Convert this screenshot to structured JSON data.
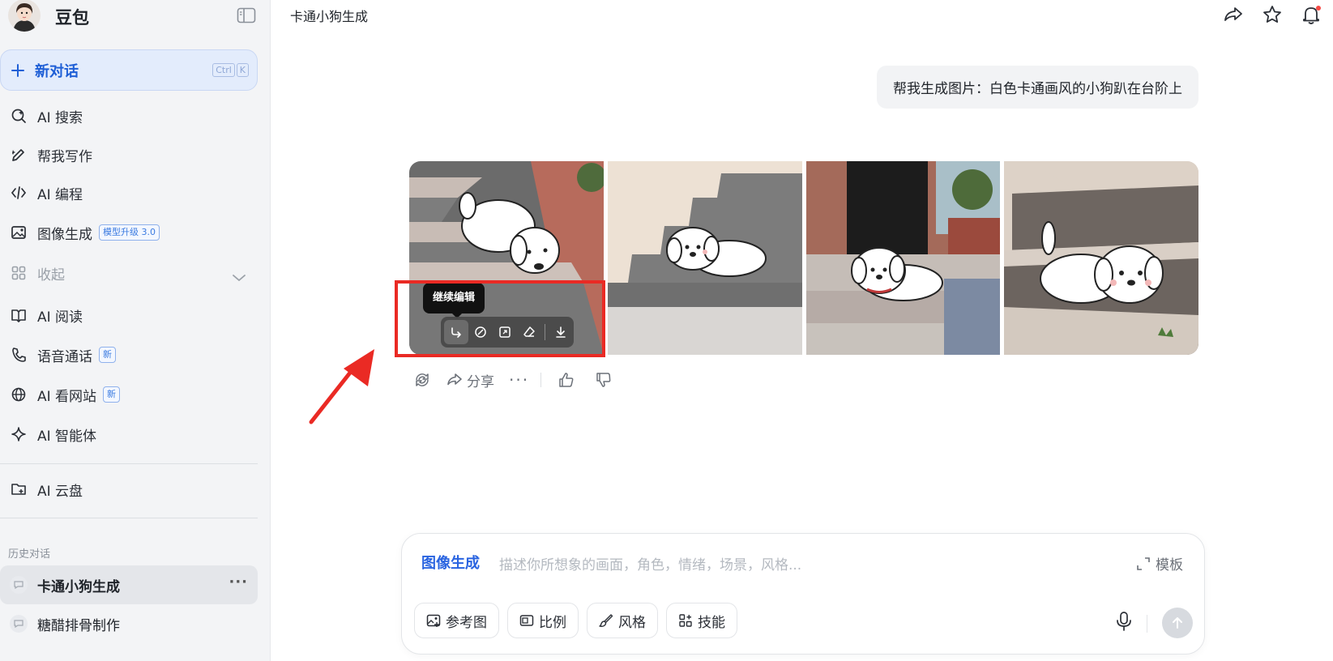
{
  "app": {
    "name": "豆包"
  },
  "sidebar": {
    "new_chat": {
      "label": "新对话",
      "shortcut": [
        "Ctrl",
        "K"
      ]
    },
    "items": [
      {
        "label": "AI 搜索",
        "icon": "search-icon"
      },
      {
        "label": "帮我写作",
        "icon": "pen-icon"
      },
      {
        "label": "AI 编程",
        "icon": "code-icon"
      },
      {
        "label": "图像生成",
        "icon": "image-icon",
        "badge": "模型升级 3.0"
      },
      {
        "label": "收起",
        "icon": "apps-icon",
        "muted": true
      },
      {
        "label": "AI 阅读",
        "icon": "book-icon"
      },
      {
        "label": "语音通话",
        "icon": "phone-icon",
        "badge": "新"
      },
      {
        "label": "AI 看网站",
        "icon": "globe-icon",
        "badge": "新"
      },
      {
        "label": "AI 智能体",
        "icon": "sparkle-icon"
      },
      {
        "label": "AI 云盘",
        "icon": "cloud-drive-icon"
      }
    ],
    "history_title": "历史对话",
    "history": [
      {
        "label": "卡通小狗生成",
        "active": true
      },
      {
        "label": "糖醋排骨制作",
        "active": false
      }
    ]
  },
  "main": {
    "title": "卡通小狗生成",
    "user_message": "帮我生成图片：白色卡通画风的小狗趴在台阶上",
    "image_toolbar_tooltip": "继续编辑",
    "actions": {
      "share_label": "分享"
    }
  },
  "input": {
    "mode": "图像生成",
    "placeholder": "描述你所想象的画面，角色，情绪，场景，风格...",
    "template_label": "模板",
    "chips": [
      {
        "label": "参考图",
        "icon": "image-ref-icon"
      },
      {
        "label": "比例",
        "icon": "ratio-icon"
      },
      {
        "label": "风格",
        "icon": "brush-icon"
      },
      {
        "label": "技能",
        "icon": "skills-icon"
      }
    ]
  },
  "colors": {
    "accent": "#1f5fd6",
    "highlight": "#ea2a24",
    "sidebar_bg": "#f3f4f6"
  }
}
